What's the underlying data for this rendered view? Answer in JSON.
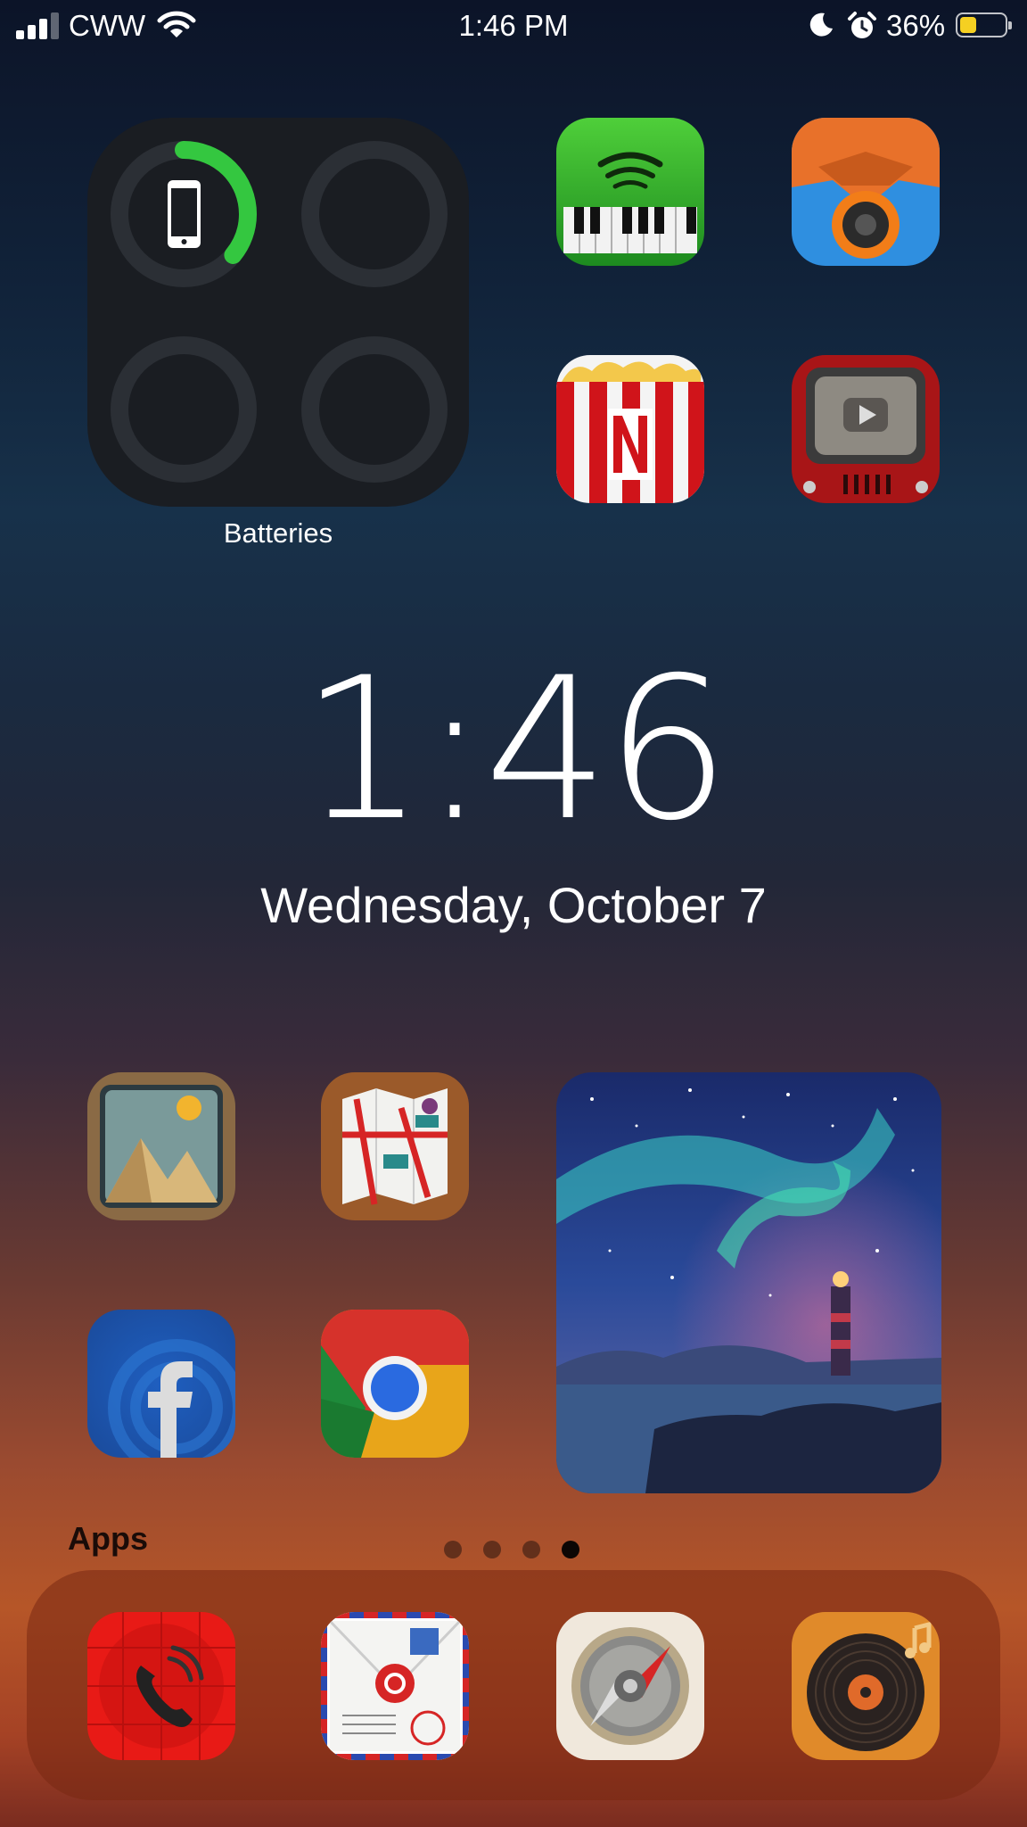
{
  "status_bar": {
    "carrier": "CWW",
    "time": "1:46 PM",
    "battery_percent": "36%",
    "battery_level": 0.36,
    "signal_icon": "cellular-signal-icon",
    "wifi_icon": "wifi-icon",
    "focus_icon": "moon-icon",
    "alarm_icon": "alarm-clock-icon"
  },
  "widgets": {
    "batteries": {
      "label": "Batteries",
      "devices": [
        {
          "device": "iPhone",
          "icon": "iphone-icon",
          "charge_fraction": 0.36,
          "ring_color": "#34c740"
        }
      ]
    },
    "photo": {
      "description_icon": "aurora-lighthouse-photo"
    }
  },
  "lock_clock": {
    "time": "1:46",
    "date": "Wednesday, October 7"
  },
  "apps": [
    {
      "id": "spotify",
      "icon": "spotify-piano-icon"
    },
    {
      "id": "overcast",
      "icon": "orange-speaker-icon"
    },
    {
      "id": "netflix",
      "icon": "netflix-popcorn-icon"
    },
    {
      "id": "youtube",
      "icon": "youtube-tv-icon"
    },
    {
      "id": "photos",
      "icon": "photos-frame-icon"
    },
    {
      "id": "maps",
      "icon": "folded-map-icon"
    },
    {
      "id": "facebook",
      "icon": "facebook-icon"
    },
    {
      "id": "chrome",
      "icon": "chrome-icon"
    }
  ],
  "folder_label": "Apps",
  "page_indicator": {
    "pages": 4,
    "current": 4
  },
  "dock": [
    {
      "id": "phone",
      "icon": "phone-icon"
    },
    {
      "id": "mail",
      "icon": "airmail-envelope-icon"
    },
    {
      "id": "safari",
      "icon": "compass-icon"
    },
    {
      "id": "music",
      "icon": "vinyl-record-icon"
    }
  ],
  "colors": {
    "accent_green": "#34c740",
    "battery_yellow": "#f5d022"
  }
}
